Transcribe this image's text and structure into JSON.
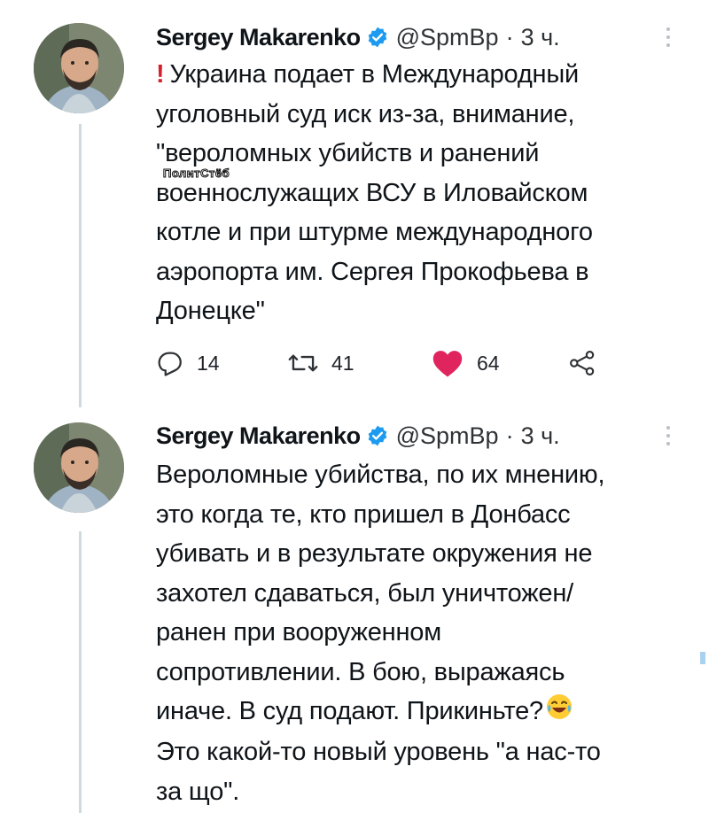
{
  "tweets": [
    {
      "author": {
        "name": "Sergey Makarenko",
        "handle": "@SpmBp",
        "verified": true
      },
      "time": "3 ч.",
      "lead_mark": "!",
      "lines": [
        "Украина подает в Международный",
        "уголовный суд иск из-за, внимание,",
        "\"вероломных убийств и ранений",
        "военнослужащих ВСУ в Иловайском",
        "котле и при штурме международного",
        "аэропорта им. Сергея Прокофьева в",
        "Донецке\""
      ],
      "actions": {
        "replies": "14",
        "retweets": "41",
        "likes": "64"
      }
    },
    {
      "author": {
        "name": "Sergey Makarenko",
        "handle": "@SpmBp",
        "verified": true
      },
      "time": "3 ч.",
      "lines": [
        "Вероломные убийства, по их мнению,",
        "это когда те, кто пришел в Донбасс",
        "убивать и в результате окружения не",
        "захотел сдаваться, был уничтожен/",
        "ранен при вооруженном",
        "сопротивлении. В бою, выражаясь",
        "иначе. В суд подают. Прикиньте?",
        "Это какой-то новый уровень \"а нас-то",
        "за що\"."
      ],
      "emoji": "face-with-tears-of-joy"
    }
  ],
  "watermark": "ПолитСтёб",
  "colors": {
    "like": "#e0245e",
    "verified": "#1d9bf0",
    "thread_line": "#cfd9de",
    "alert": "#d61f2c"
  },
  "icons": [
    "reply-icon",
    "retweet-icon",
    "heart-icon",
    "share-icon",
    "verified-badge-icon",
    "more-icon"
  ]
}
